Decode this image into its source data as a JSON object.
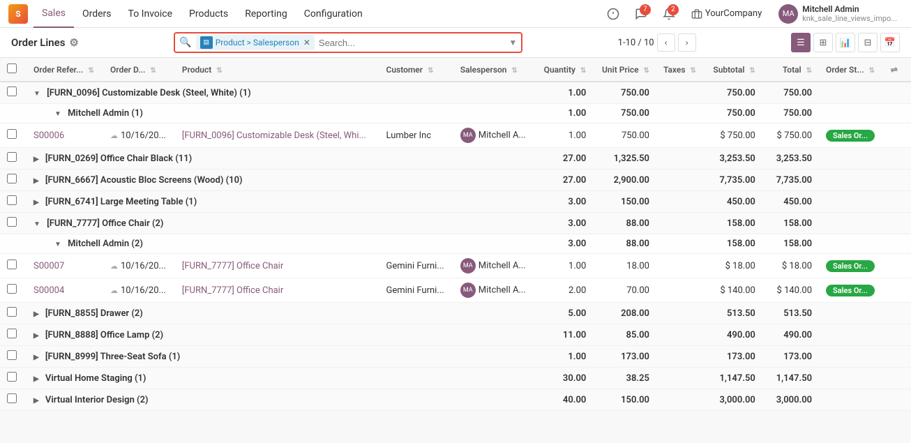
{
  "topbar": {
    "logo": "S",
    "nav_items": [
      "Sales",
      "Orders",
      "To Invoice",
      "Products",
      "Reporting",
      "Configuration"
    ],
    "active_nav": "Sales",
    "notifications": {
      "messages": "7",
      "alerts": "2"
    },
    "company": "YourCompany",
    "user": {
      "name": "Mitchell Admin",
      "sub": "knk_sale_line_views_impo...",
      "initials": "MA"
    }
  },
  "actionbar": {
    "title": "Order Lines",
    "pagination": "1-10 / 10",
    "filter_tag": "Product > Salesperson",
    "search_placeholder": "Search..."
  },
  "table": {
    "columns": [
      "",
      "Order Refer...",
      "Order D...",
      "Product",
      "Customer",
      "Salesperson",
      "Quantity",
      "Unit Price",
      "Taxes",
      "Subtotal",
      "Total",
      "Order St...",
      ""
    ],
    "rows": [
      {
        "type": "group",
        "indent": 0,
        "label": "[FURN_0096] Customizable Desk (Steel, White) (1)",
        "qty": "1.00",
        "unit_price": "750.00",
        "subtotal": "750.00",
        "total": "750.00"
      },
      {
        "type": "subgroup",
        "indent": 1,
        "label": "Mitchell Admin (1)",
        "qty": "1.00",
        "unit_price": "750.00",
        "subtotal": "750.00",
        "total": "750.00"
      },
      {
        "type": "data",
        "ref": "S00006",
        "date": "10/16/20...",
        "product": "[FURN_0096] Customizable Desk (Steel, Whi...",
        "customer": "Lumber Inc",
        "salesperson": "Mitchell A...",
        "qty": "1.00",
        "unit_price": "750.00",
        "taxes": "",
        "subtotal": "$ 750.00",
        "total": "$ 750.00",
        "status": "Sales Or..."
      },
      {
        "type": "group",
        "indent": 0,
        "label": "[FURN_0269] Office Chair Black (11)",
        "qty": "27.00",
        "unit_price": "1,325.50",
        "subtotal": "3,253.50",
        "total": "3,253.50"
      },
      {
        "type": "group",
        "indent": 0,
        "label": "[FURN_6667] Acoustic Bloc Screens (Wood) (10)",
        "qty": "27.00",
        "unit_price": "2,900.00",
        "subtotal": "7,735.00",
        "total": "7,735.00"
      },
      {
        "type": "group",
        "indent": 0,
        "label": "[FURN_6741] Large Meeting Table (1)",
        "qty": "3.00",
        "unit_price": "150.00",
        "subtotal": "450.00",
        "total": "450.00"
      },
      {
        "type": "group",
        "indent": 0,
        "label": "[FURN_7777] Office Chair (2)",
        "qty": "3.00",
        "unit_price": "88.00",
        "subtotal": "158.00",
        "total": "158.00"
      },
      {
        "type": "subgroup",
        "indent": 1,
        "label": "Mitchell Admin (2)",
        "qty": "3.00",
        "unit_price": "88.00",
        "subtotal": "158.00",
        "total": "158.00"
      },
      {
        "type": "data",
        "ref": "S00007",
        "date": "10/16/20...",
        "product": "[FURN_7777] Office Chair",
        "customer": "Gemini Furni...",
        "salesperson": "Mitchell A...",
        "qty": "1.00",
        "unit_price": "18.00",
        "taxes": "",
        "subtotal": "$ 18.00",
        "total": "$ 18.00",
        "status": "Sales Or..."
      },
      {
        "type": "data",
        "ref": "S00004",
        "date": "10/16/20...",
        "product": "[FURN_7777] Office Chair",
        "customer": "Gemini Furni...",
        "salesperson": "Mitchell A...",
        "qty": "2.00",
        "unit_price": "70.00",
        "taxes": "",
        "subtotal": "$ 140.00",
        "total": "$ 140.00",
        "status": "Sales Or..."
      },
      {
        "type": "group",
        "indent": 0,
        "label": "[FURN_8855] Drawer (2)",
        "qty": "5.00",
        "unit_price": "208.00",
        "subtotal": "513.50",
        "total": "513.50"
      },
      {
        "type": "group",
        "indent": 0,
        "label": "[FURN_8888] Office Lamp (2)",
        "qty": "11.00",
        "unit_price": "85.00",
        "subtotal": "490.00",
        "total": "490.00"
      },
      {
        "type": "group",
        "indent": 0,
        "label": "[FURN_8999] Three-Seat Sofa (1)",
        "qty": "1.00",
        "unit_price": "173.00",
        "subtotal": "173.00",
        "total": "173.00"
      },
      {
        "type": "group",
        "indent": 0,
        "label": "Virtual Home Staging (1)",
        "qty": "30.00",
        "unit_price": "38.25",
        "subtotal": "1,147.50",
        "total": "1,147.50"
      },
      {
        "type": "group",
        "indent": 0,
        "label": "Virtual Interior Design (2)",
        "qty": "40.00",
        "unit_price": "150.00",
        "subtotal": "3,000.00",
        "total": "3,000.00"
      }
    ]
  }
}
